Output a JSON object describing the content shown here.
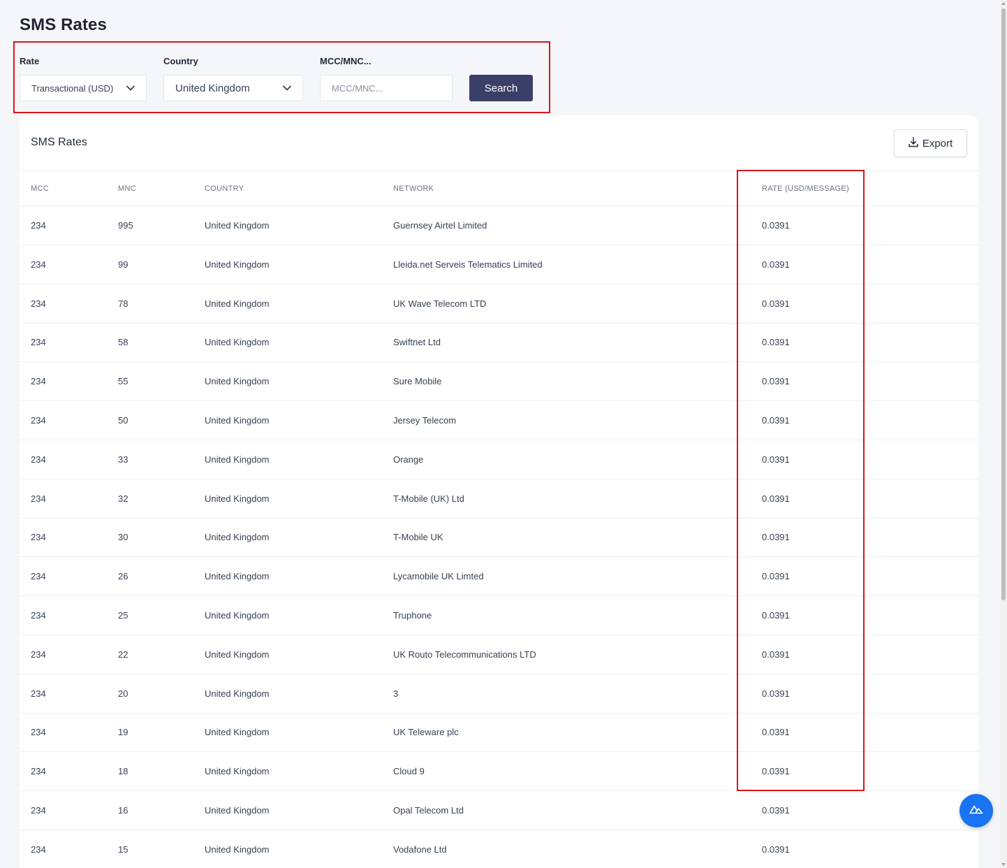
{
  "page": {
    "title": "SMS Rates"
  },
  "filters": {
    "rate_label": "Rate",
    "rate_value": "Transactional (USD)",
    "country_label": "Country",
    "country_value": "United Kingdom",
    "mccmnc_label": "MCC/MNC...",
    "mccmnc_placeholder": "MCC/MNC...",
    "mccmnc_value": "",
    "search_label": "Search"
  },
  "card": {
    "title": "SMS Rates",
    "export_label": "Export"
  },
  "table": {
    "headers": {
      "mcc": "MCC",
      "mnc": "MNC",
      "country": "COUNTRY",
      "network": "NETWORK",
      "rate": "RATE (USD/MESSAGE)"
    },
    "rows": [
      {
        "mcc": "234",
        "mnc": "995",
        "country": "United Kingdom",
        "network": "Guernsey Airtel Limited",
        "rate": "0.0391"
      },
      {
        "mcc": "234",
        "mnc": "99",
        "country": "United Kingdom",
        "network": "Lleida.net Serveis Telematics Limited",
        "rate": "0.0391"
      },
      {
        "mcc": "234",
        "mnc": "78",
        "country": "United Kingdom",
        "network": "UK Wave Telecom LTD",
        "rate": "0.0391"
      },
      {
        "mcc": "234",
        "mnc": "58",
        "country": "United Kingdom",
        "network": "Swiftnet Ltd",
        "rate": "0.0391"
      },
      {
        "mcc": "234",
        "mnc": "55",
        "country": "United Kingdom",
        "network": "Sure Mobile",
        "rate": "0.0391"
      },
      {
        "mcc": "234",
        "mnc": "50",
        "country": "United Kingdom",
        "network": "Jersey Telecom",
        "rate": "0.0391"
      },
      {
        "mcc": "234",
        "mnc": "33",
        "country": "United Kingdom",
        "network": "Orange",
        "rate": "0.0391"
      },
      {
        "mcc": "234",
        "mnc": "32",
        "country": "United Kingdom",
        "network": "T-Mobile (UK) Ltd",
        "rate": "0.0391"
      },
      {
        "mcc": "234",
        "mnc": "30",
        "country": "United Kingdom",
        "network": "T-Mobile UK",
        "rate": "0.0391"
      },
      {
        "mcc": "234",
        "mnc": "26",
        "country": "United Kingdom",
        "network": "Lycamobile UK Limted",
        "rate": "0.0391"
      },
      {
        "mcc": "234",
        "mnc": "25",
        "country": "United Kingdom",
        "network": "Truphone",
        "rate": "0.0391"
      },
      {
        "mcc": "234",
        "mnc": "22",
        "country": "United Kingdom",
        "network": "UK Routo Telecommunications LTD",
        "rate": "0.0391"
      },
      {
        "mcc": "234",
        "mnc": "20",
        "country": "United Kingdom",
        "network": "3",
        "rate": "0.0391"
      },
      {
        "mcc": "234",
        "mnc": "19",
        "country": "United Kingdom",
        "network": "UK Teleware plc",
        "rate": "0.0391"
      },
      {
        "mcc": "234",
        "mnc": "18",
        "country": "United Kingdom",
        "network": "Cloud 9",
        "rate": "0.0391"
      },
      {
        "mcc": "234",
        "mnc": "16",
        "country": "United Kingdom",
        "network": "Opal Telecom Ltd",
        "rate": "0.0391"
      },
      {
        "mcc": "234",
        "mnc": "15",
        "country": "United Kingdom",
        "network": "Vodafone Ltd",
        "rate": "0.0391"
      }
    ]
  },
  "icons": {
    "rate_dropdown": "chevron-down-icon",
    "country_dropdown": "chevron-down-icon",
    "export": "download-icon",
    "fab": "nuxt-logo-icon"
  },
  "colors": {
    "primary_button": "#3a3f68",
    "highlight_box": "#d9151b",
    "fab": "#1a73f0"
  }
}
